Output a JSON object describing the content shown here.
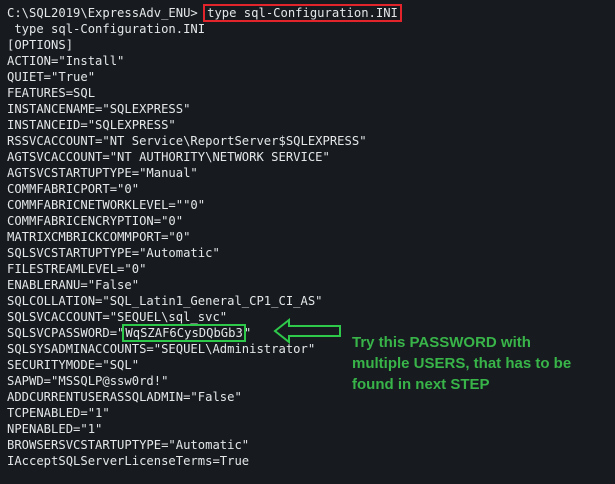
{
  "terminal": {
    "prompt": "C:\\SQL2019\\ExpressAdv_ENU>",
    "command": "type sql-Configuration.INI",
    "echo": " type sql-Configuration.INI",
    "config_lines_before_password": [
      "[OPTIONS]",
      "ACTION=\"Install\"",
      "QUIET=\"True\"",
      "FEATURES=SQL",
      "INSTANCENAME=\"SQLEXPRESS\"",
      "INSTANCEID=\"SQLEXPRESS\"",
      "RSSVCACCOUNT=\"NT Service\\ReportServer$SQLEXPRESS\"",
      "AGTSVCACCOUNT=\"NT AUTHORITY\\NETWORK SERVICE\"",
      "AGTSVCSTARTUPTYPE=\"Manual\"",
      "COMMFABRICPORT=\"0\"",
      "COMMFABRICNETWORKLEVEL=\"\"0\"",
      "COMMFABRICENCRYPTION=\"0\"",
      "MATRIXCMBRICKCOMMPORT=\"0\"",
      "SQLSVCSTARTUPTYPE=\"Automatic\"",
      "FILESTREAMLEVEL=\"0\"",
      "ENABLERANU=\"False\"",
      "SQLCOLLATION=\"SQL_Latin1_General_CP1_CI_AS\"",
      "SQLSVCACCOUNT=\"SEQUEL\\sql_svc\""
    ],
    "password_key": "SQLSVCPASSWORD=\"",
    "password_value": "WqSZAF6CysDQbGb3",
    "password_suffix": "\"",
    "config_lines_after_password": [
      "SQLSYSADMINACCOUNTS=\"SEQUEL\\Administrator\"",
      "SECURITYMODE=\"SQL\"",
      "SAPWD=\"MSSQLP@ssw0rd!\"",
      "ADDCURRENTUSERASSQLADMIN=\"False\"",
      "TCPENABLED=\"1\"",
      "NPENABLED=\"1\"",
      "BROWSERSVCSTARTUPTYPE=\"Automatic\"",
      "IAcceptSQLServerLicenseTerms=True"
    ]
  },
  "annotation": {
    "text": "Try this PASSWORD with\nmultiple USERS, that has to be\nfound in next STEP",
    "color": "#38b449"
  },
  "colors": {
    "background": "#171b1f",
    "text": "#e4e6e8",
    "command_box": "#e3242b",
    "password_box": "#2ec84a"
  },
  "icons": {
    "arrow": "arrow-left-icon"
  }
}
